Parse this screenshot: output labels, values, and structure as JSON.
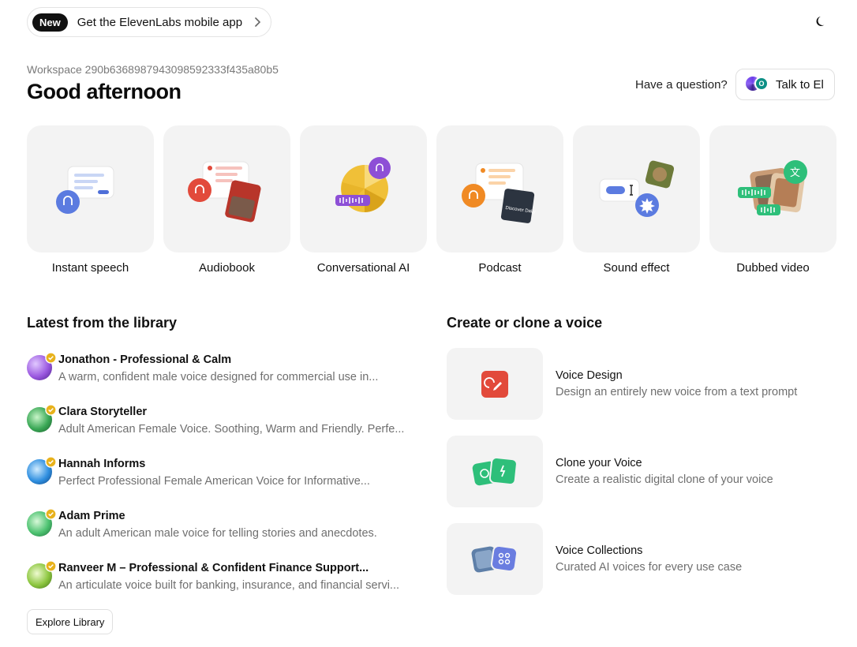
{
  "promo": {
    "badge": "New",
    "text": "Get the ElevenLabs mobile app"
  },
  "header": {
    "workspace": "Workspace 290b6368987943098592333f435a80b5",
    "greeting": "Good afternoon",
    "question": "Have a question?",
    "talk_button": "Talk to El",
    "talk_avatar_letter": "O"
  },
  "tiles": [
    {
      "label": "Instant speech",
      "icon": "instant-speech-illustration"
    },
    {
      "label": "Audiobook",
      "icon": "audiobook-illustration"
    },
    {
      "label": "Conversational AI",
      "icon": "conversational-ai-illustration"
    },
    {
      "label": "Podcast",
      "icon": "podcast-illustration"
    },
    {
      "label": "Sound effect",
      "icon": "sound-effect-illustration"
    },
    {
      "label": "Dubbed video",
      "icon": "dubbed-video-illustration"
    }
  ],
  "podcast_cover_text": "Discover Daily",
  "library": {
    "title": "Latest from the library",
    "items": [
      {
        "name": "Jonathon - Professional & Calm",
        "desc": "A warm, confident male voice designed for commercial use in...",
        "color": "#9b59e0"
      },
      {
        "name": "Clara Storyteller",
        "desc": "Adult American Female Voice. Soothing, Warm and Friendly. Perfe...",
        "color": "#3aa856"
      },
      {
        "name": "Hannah Informs",
        "desc": "Perfect Professional Female American Voice for Informative...",
        "color": "#2f8fe0"
      },
      {
        "name": "Adam Prime",
        "desc": "An adult American male voice for telling stories and anecdotes.",
        "color": "#4cc270"
      },
      {
        "name": "Ranveer M – Professional & Confident Finance Support...",
        "desc": "An articulate voice built for banking, insurance, and financial servi...",
        "color": "#8cc63f"
      }
    ],
    "explore_button": "Explore Library"
  },
  "create": {
    "title": "Create or clone a voice",
    "items": [
      {
        "title": "Voice Design",
        "desc": "Design an entirely new voice from a text prompt",
        "icon": "voice-design-icon"
      },
      {
        "title": "Clone your Voice",
        "desc": "Create a realistic digital clone of your voice",
        "icon": "clone-voice-icon"
      },
      {
        "title": "Voice Collections",
        "desc": "Curated AI voices for every use case",
        "icon": "voice-collections-icon"
      }
    ]
  }
}
